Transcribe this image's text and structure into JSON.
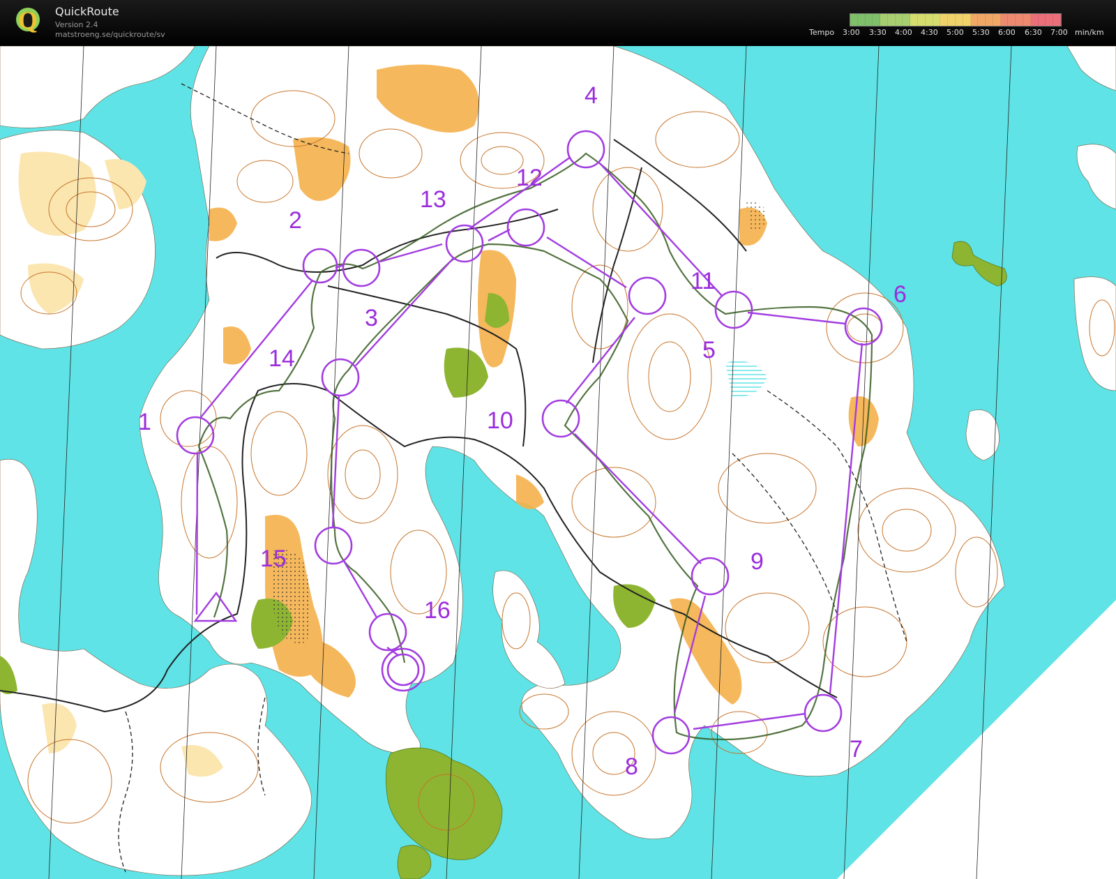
{
  "app": {
    "title": "QuickRoute",
    "version": "Version 2.4",
    "url": "matstroeng.se/quickroute/sv",
    "logo_letter": "Q"
  },
  "tempo": {
    "label": "Tempo",
    "ticks": [
      "3:00",
      "3:30",
      "4:00",
      "4:30",
      "5:00",
      "5:30",
      "6:00",
      "6:30",
      "7:00"
    ],
    "unit": "min/km",
    "gradient_colors": [
      "#7fbf6a",
      "#a8cf6f",
      "#d6dd6e",
      "#f0d26a",
      "#f1a766",
      "#ee8a6f",
      "#ea6f79"
    ]
  },
  "map": {
    "colors": {
      "water": "#5fe3e6",
      "forest": "#ffffff",
      "open_land": "#f5b04a",
      "rough_open": "#fbe6b0",
      "green": "#8db531",
      "contour": "#c6742a",
      "course": "#a23ce0",
      "route": "#355a1f"
    },
    "controls": [
      "1",
      "2",
      "3",
      "4",
      "5",
      "6",
      "7",
      "8",
      "9",
      "10",
      "11",
      "12",
      "13",
      "14",
      "15",
      "16"
    ]
  }
}
